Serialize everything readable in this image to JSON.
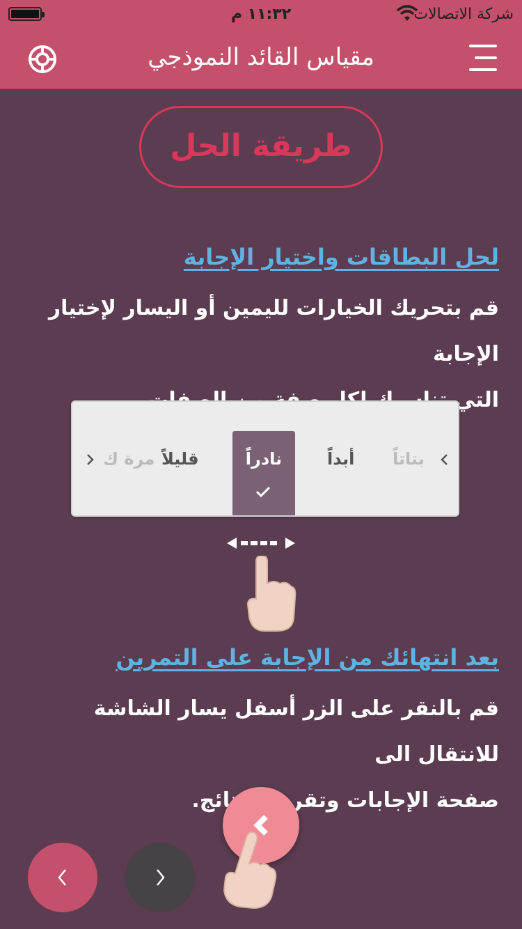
{
  "status_bar": {
    "carrier": "شركة الاتصالات",
    "time": "١١:٣٢ م",
    "battery_level": 1.0
  },
  "nav": {
    "title": "مقياس القائد النموذجي",
    "menu_icon": "hamburger-icon",
    "help_icon": "lifebuoy-icon"
  },
  "solution_button": {
    "label": "طريقة الحل"
  },
  "section1": {
    "heading": "لحل البطاقات واختيار الإجابة",
    "line1": "قم بتحريك الخيارات لليمين أو اليسار لإختيار الإجابة",
    "line2": "التي تناسبك لكل صفة من الصفات."
  },
  "picker": {
    "options": [
      "بتاتاً",
      "أبداً",
      "نادراً",
      "قليلاً",
      "مرة ك"
    ],
    "selected": "نادراً",
    "selected_icon": "checkmark-icon"
  },
  "section2": {
    "heading": "بعد انتهائك من الإجابة على التمرين",
    "line1": "قم بالنقر على الزر أسفل يسار الشاشة للانتقال الى",
    "line2": "صفحة الإجابات وتقرير النتائج."
  },
  "colors": {
    "header": "#c4506c",
    "background": "#5b3c50",
    "accent": "#d8385a",
    "link": "#5fb3e3",
    "fab": "#f08a94",
    "next_button": "#474245"
  }
}
